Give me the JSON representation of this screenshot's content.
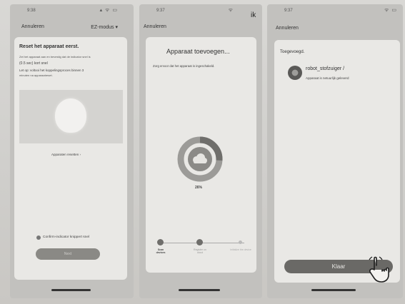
{
  "screen1": {
    "status_time": "9:38",
    "status_icons": "▴ ᯤ ▭",
    "nav_left": "Annuleren",
    "nav_right": "EZ-modus",
    "title": "Reset het apparaat eerst.",
    "line1": "Zet het apparaat aan en bevestig dat de indicator snel is",
    "line2": "(0.5 sec) kort snel",
    "line3": "Let op: voltooi het koppelingsproces binnen 3",
    "line4": "minuten na apparaatreset.",
    "reset_link": "Apparaten resetten",
    "confirm_label": "Confirm-indicator knippert snel",
    "next_button": "Next"
  },
  "screen2": {
    "status_time": "9:37",
    "status_icons": "ᯤ",
    "overlay_text": "ik",
    "nav_left": "Annuleren",
    "title": "Apparaat toevoegen...",
    "subtitle": "Zorg ervoor dat het apparaat is ingeschakeld.",
    "progress_label": "26%",
    "progress_value": 0.26,
    "step1": "Scan devices",
    "step2": "Register on cloud",
    "step3": "Initialize the device"
  },
  "screen3": {
    "status_time": "9:37",
    "status_icons": "ᯤ ▭",
    "nav_left": "Annuleren",
    "added_label": "Toegevoegd.",
    "device_name": "robot_stofzuiger",
    "device_edit": "/",
    "device_status": "Apparaat is netuurlijk geleverd",
    "done_button": "Klaar"
  }
}
